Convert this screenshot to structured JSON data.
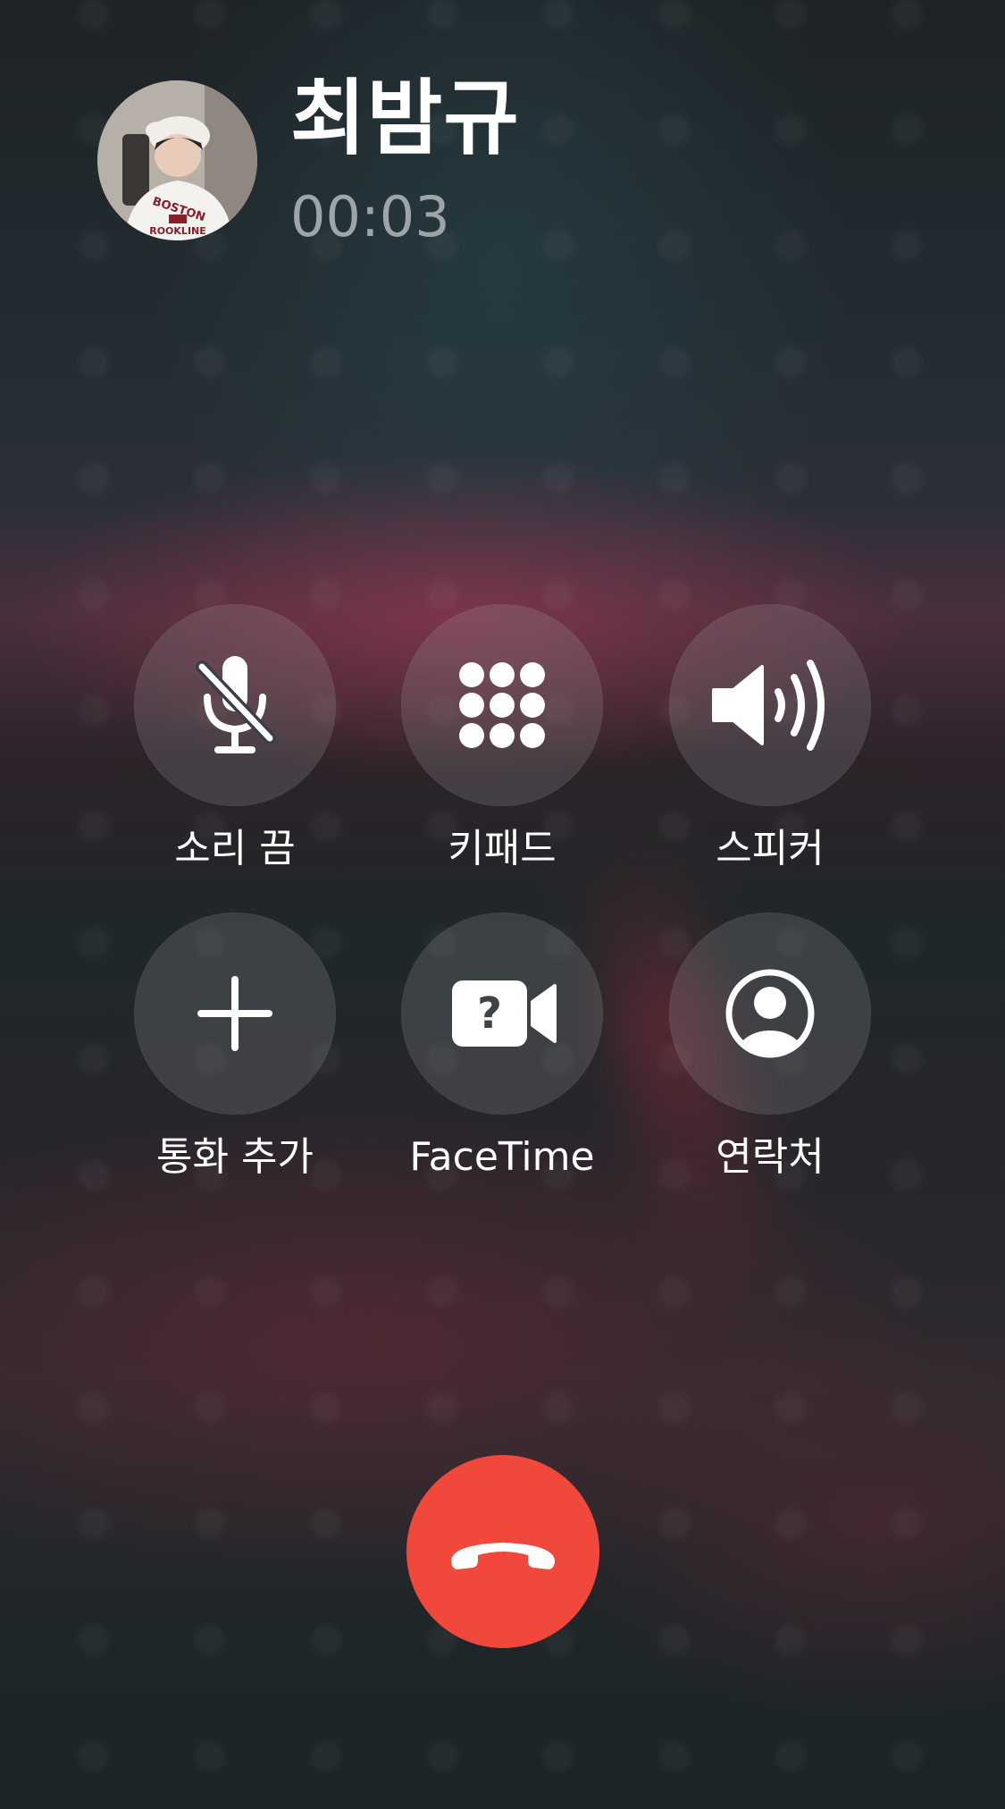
{
  "caller": {
    "name": "최밤규",
    "duration": "00:03",
    "avatar_icon": "contact-photo"
  },
  "controls": [
    {
      "id": "mute",
      "label": "소리 끔",
      "icon": "mic-slash-icon"
    },
    {
      "id": "keypad",
      "label": "키패드",
      "icon": "keypad-grid-icon"
    },
    {
      "id": "speaker",
      "label": "스피커",
      "icon": "speaker-wave-icon"
    },
    {
      "id": "add-call",
      "label": "통화 추가",
      "icon": "plus-icon"
    },
    {
      "id": "facetime",
      "label": "FaceTime",
      "icon": "video-question-icon"
    },
    {
      "id": "contacts",
      "label": "연락처",
      "icon": "person-circle-icon"
    }
  ],
  "end_call": {
    "icon": "phone-down-icon",
    "color": "#f2473b"
  }
}
